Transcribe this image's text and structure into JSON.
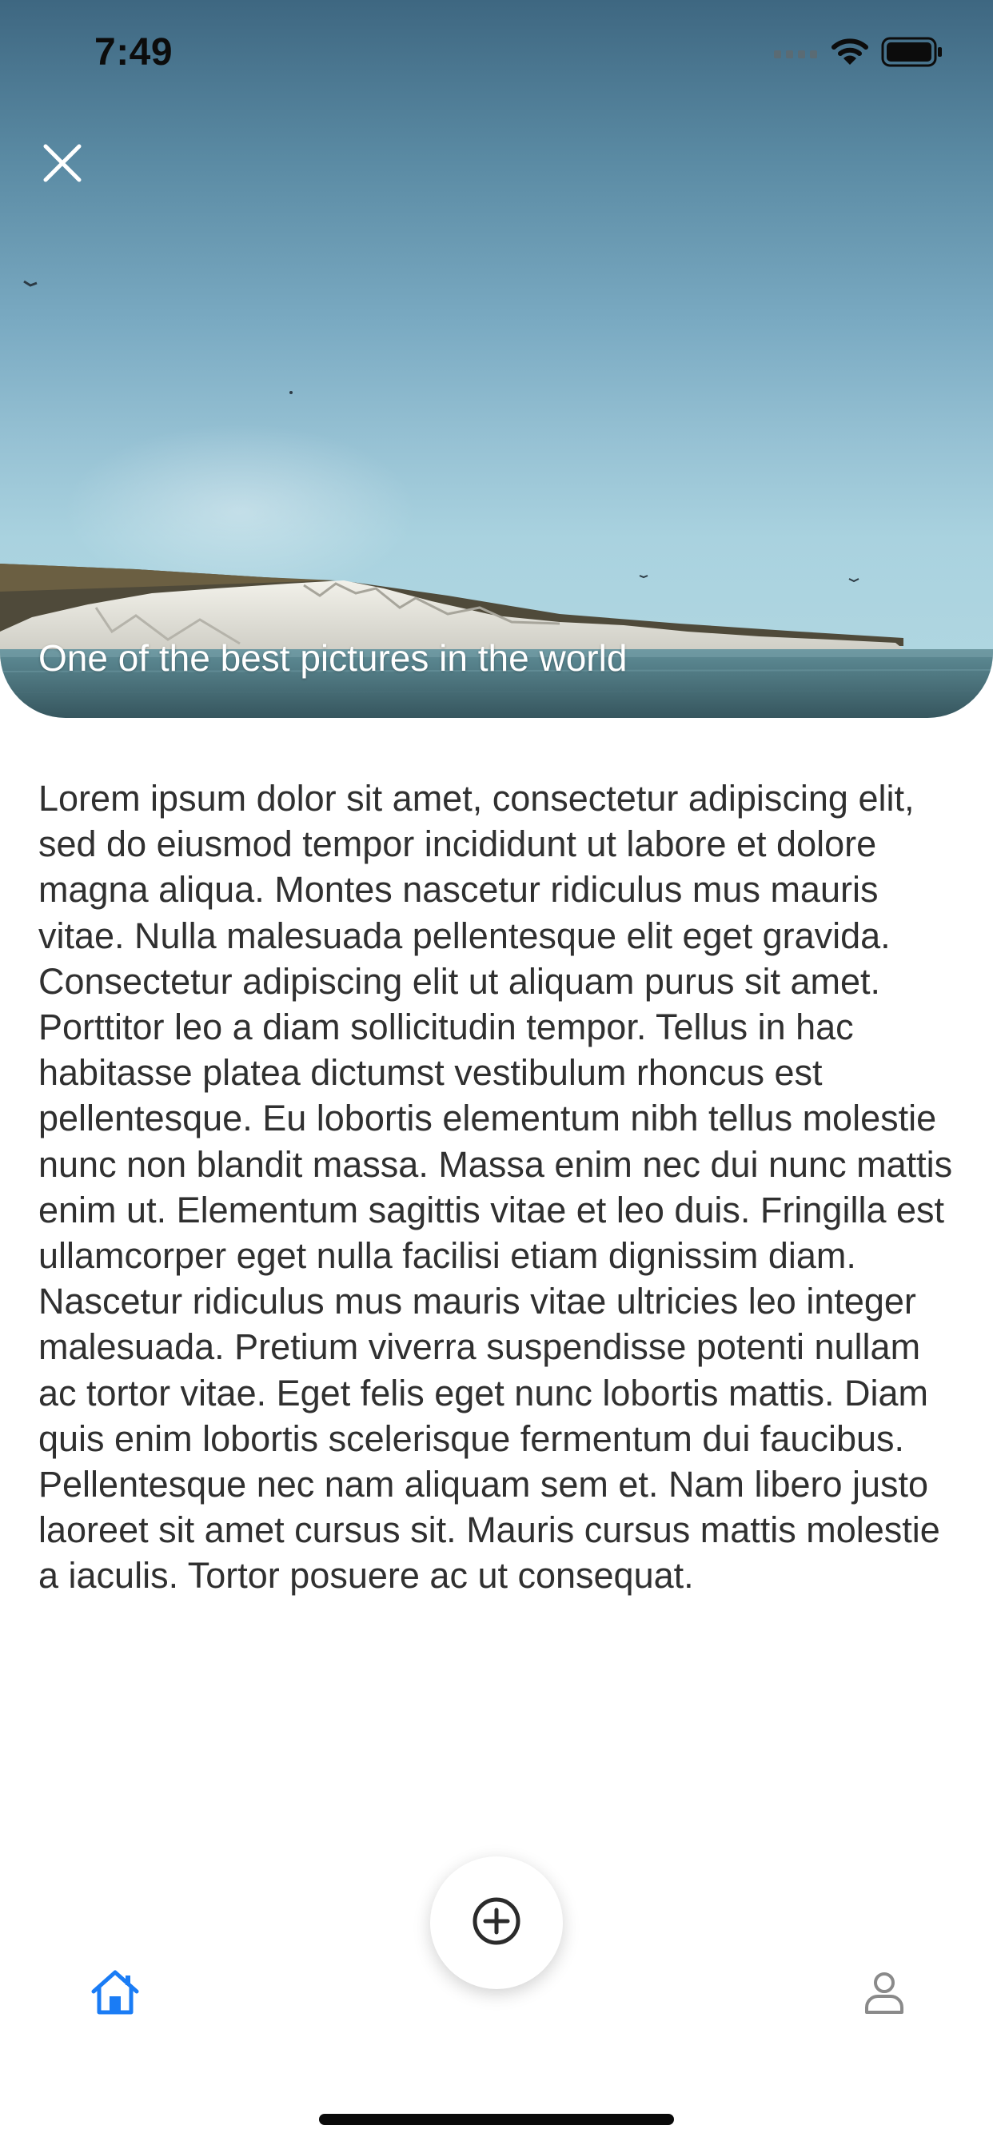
{
  "status_bar": {
    "time": "7:49",
    "signal_icon": "cellular-signal-icon",
    "wifi_icon": "wifi-icon",
    "battery_icon": "battery-icon"
  },
  "hero": {
    "caption": "One of the best pictures in the world",
    "close_icon": "close-icon"
  },
  "article": {
    "body": "Lorem ipsum dolor sit amet, consectetur adipiscing elit, sed do eiusmod tempor incididunt ut labore et dolore magna aliqua. Montes nascetur ridiculus mus mauris vitae. Nulla malesuada pellentesque elit eget gravida. Consectetur adipiscing elit ut aliquam purus sit amet. Porttitor leo a diam sollicitudin tempor. Tellus in hac habitasse platea dictumst vestibulum rhoncus est pellentesque. Eu lobortis elementum nibh tellus molestie nunc non blandit massa. Massa enim nec dui nunc mattis enim ut. Elementum sagittis vitae et leo duis. Fringilla est ullamcorper eget nulla facilisi etiam dignissim diam. Nascetur ridiculus mus mauris vitae ultricies leo integer malesuada. Pretium viverra suspendisse potenti nullam ac tortor vitae. Eget felis eget nunc lobortis mattis. Diam quis enim lobortis scelerisque fermentum dui faucibus. Pellentesque nec nam aliquam sem et. Nam libero justo laoreet sit amet cursus sit. Mauris cursus mattis molestie a iaculis. Tortor posuere ac ut consequat."
  },
  "tab_bar": {
    "home_icon": "home-icon",
    "add_icon": "add-circle-icon",
    "profile_icon": "person-icon",
    "active_tab": "home"
  },
  "colors": {
    "accent": "#1a7cf5",
    "text": "#303030",
    "inactive_icon": "#8a8a8a"
  }
}
